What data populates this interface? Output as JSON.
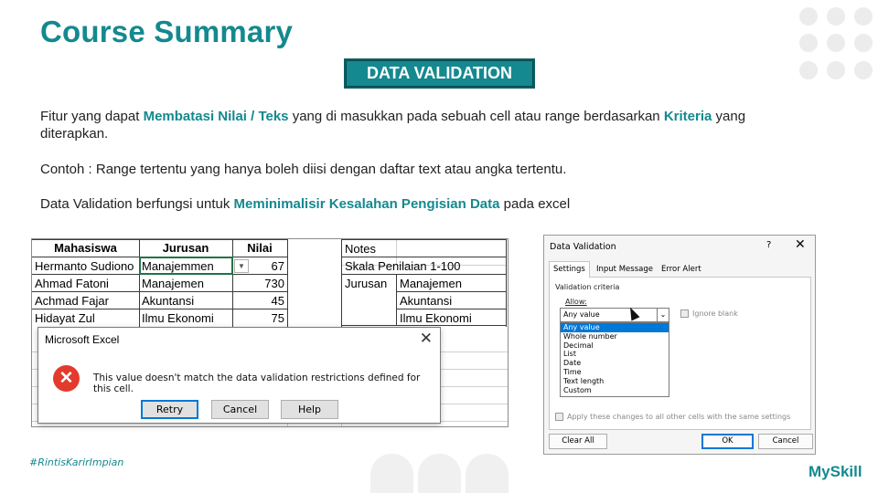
{
  "slide": {
    "title": "Course Summary",
    "badge": "DATA VALIDATION",
    "para1": {
      "t1": "Fitur yang dapat ",
      "h1": "Membatasi Nilai / Teks",
      "t2": " yang di masukkan pada sebuah cell atau range berdasarkan ",
      "h2": "Kriteria",
      "t3": " yang diterapkan."
    },
    "para2": "Contoh : Range tertentu  yang hanya boleh diisi dengan daftar text atau angka tertentu.",
    "para3": {
      "t1": "Data Validation berfungsi untuk ",
      "h1": "Meminimalisir Kesalahan Pengisian Data",
      "t2": " pada excel"
    },
    "hashtag": "#RintisKarirImpian",
    "logo": "MySkill",
    "accent_color": "#14898f"
  },
  "excel": {
    "headers": [
      "Mahasiswa",
      "Jurusan",
      "Nilai"
    ],
    "rows": [
      [
        "Hermanto Sudiono",
        "Manajemmen",
        "67"
      ],
      [
        "Ahmad Fatoni",
        "Manajemen",
        "730"
      ],
      [
        "Achmad Fajar",
        "Akuntansi",
        "45"
      ],
      [
        "Hidayat Zul",
        "Ilmu Ekonomi",
        "75"
      ]
    ],
    "notes": {
      "label": "Notes",
      "scale": "Skala Penilaian 1-100",
      "jurusan_label": "Jurusan",
      "jurusan_values": [
        "Manajemen",
        "Akuntansi",
        "Ilmu Ekonomi"
      ]
    }
  },
  "msgbox": {
    "title": "Microsoft Excel",
    "icon": "error-icon",
    "message": "This value doesn't match the data validation restrictions defined for this cell.",
    "buttons": {
      "retry": "Retry",
      "cancel": "Cancel",
      "help": "Help"
    }
  },
  "dv_dialog": {
    "title": "Data Validation",
    "help": "?",
    "tabs": [
      "Settings",
      "Input Message",
      "Error Alert"
    ],
    "section": "Validation criteria",
    "allow_label": "Allow:",
    "allow_value": "Any value",
    "ignore_blank": "Ignore blank",
    "options": [
      "Any value",
      "Whole number",
      "Decimal",
      "List",
      "Date",
      "Time",
      "Text length",
      "Custom"
    ],
    "apply_all": "Apply these changes to all other cells with the same settings",
    "buttons": {
      "clear": "Clear All",
      "ok": "OK",
      "cancel": "Cancel"
    }
  }
}
